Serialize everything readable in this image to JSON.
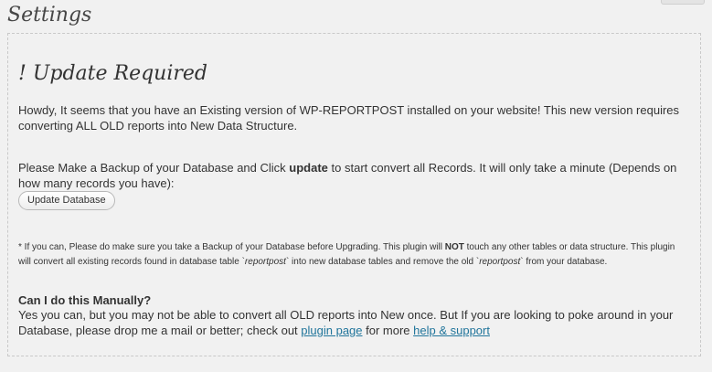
{
  "header": {
    "title": "Settings"
  },
  "panel": {
    "heading": "! Update Required",
    "intro": "Howdy, It seems that you have an Existing version of WP-REPORTPOST installed on your website! This new version requires converting ALL OLD reports into New Data Structure.",
    "backup_pre": "Please Make a Backup of your Database and Click ",
    "backup_bold": "update",
    "backup_post": " to start convert all Records. It will only take a minute (Depends on how many records you have):",
    "update_button": "Update Database",
    "note_1": "* If you can, Please do make sure you take a Backup of your Database before Upgrading. This plugin will ",
    "note_not": "NOT",
    "note_2": " touch any other tables or data structure. This plugin will convert all existing records found in database table `",
    "note_table1": "reportpost",
    "note_3": "` into new database tables and remove the old `",
    "note_table2": "reportpost",
    "note_4": "` from your database.",
    "manual_title": "Can I do this Manually?",
    "manual_text": "Yes you can, but you may not be able to convert all OLD reports into New once. But If you are looking to poke around in your Database, please drop me a mail or better; check out ",
    "plugin_page_link": "plugin page",
    "manual_mid": " for more ",
    "help_link": "help & support"
  }
}
